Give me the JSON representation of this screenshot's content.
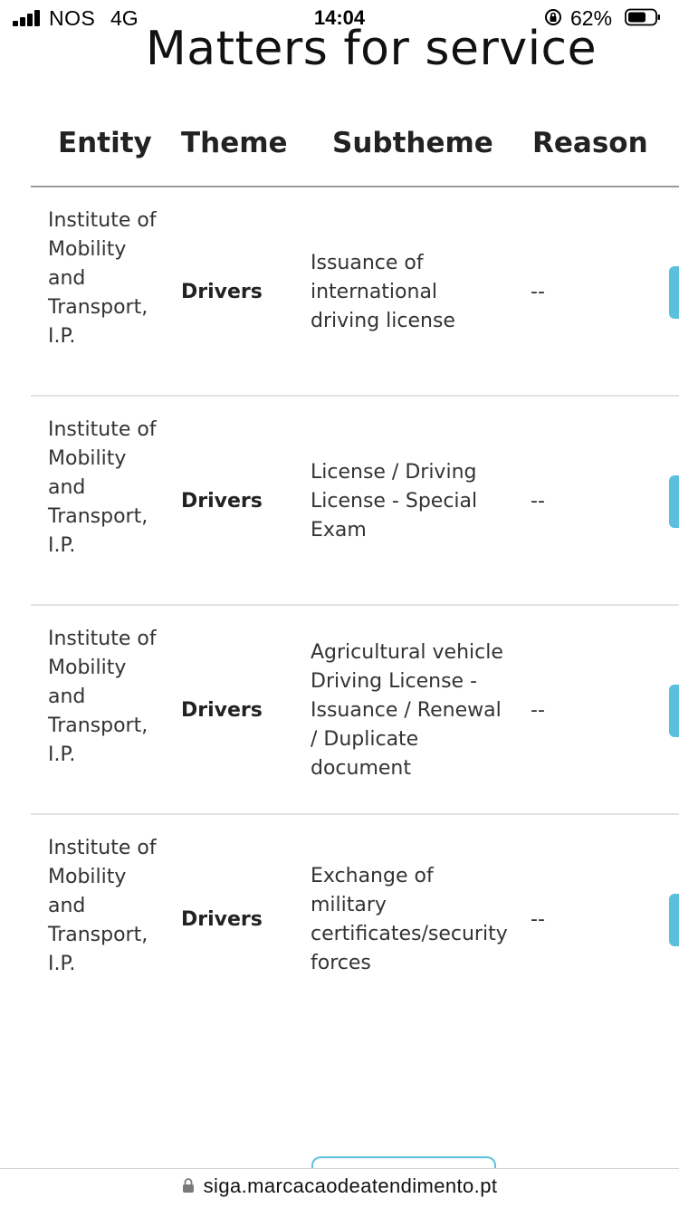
{
  "status_bar": {
    "carrier": "NOS",
    "network": "4G",
    "time": "14:04",
    "battery_percent": "62%",
    "signal_icon": "cellular-signal-icon",
    "lock_icon": "rotation-lock-icon",
    "battery_icon": "battery-icon"
  },
  "page": {
    "title": "Matters for service"
  },
  "table": {
    "headers": {
      "entity": "Entity",
      "theme": "Theme",
      "subtheme": "Subtheme",
      "reason": "Reason"
    },
    "rows": [
      {
        "entity": "Institute of Mobility and Transport, I.P.",
        "theme": "Drivers",
        "subtheme": "Issuance of international driving license",
        "reason": "--"
      },
      {
        "entity": "Institute of Mobility and Transport, I.P.",
        "theme": "Drivers",
        "subtheme": "License / Driving License - Special Exam",
        "reason": "--"
      },
      {
        "entity": "Institute of Mobility and Transport, I.P.",
        "theme": "Drivers",
        "subtheme": "Agricultural vehicle Driving License - Issuance / Renewal / Duplicate document",
        "reason": "--"
      },
      {
        "entity": "Institute of Mobility and Transport, I.P.",
        "theme": "Drivers",
        "subtheme": "Exchange of military certificates/security forces",
        "reason": "--"
      }
    ]
  },
  "browser": {
    "url": "siga.marcacaodeatendimento.pt",
    "url_icon": "lock-icon"
  },
  "colors": {
    "accent": "#5bc0de",
    "text": "#333333",
    "divider": "#e2e2e2"
  }
}
